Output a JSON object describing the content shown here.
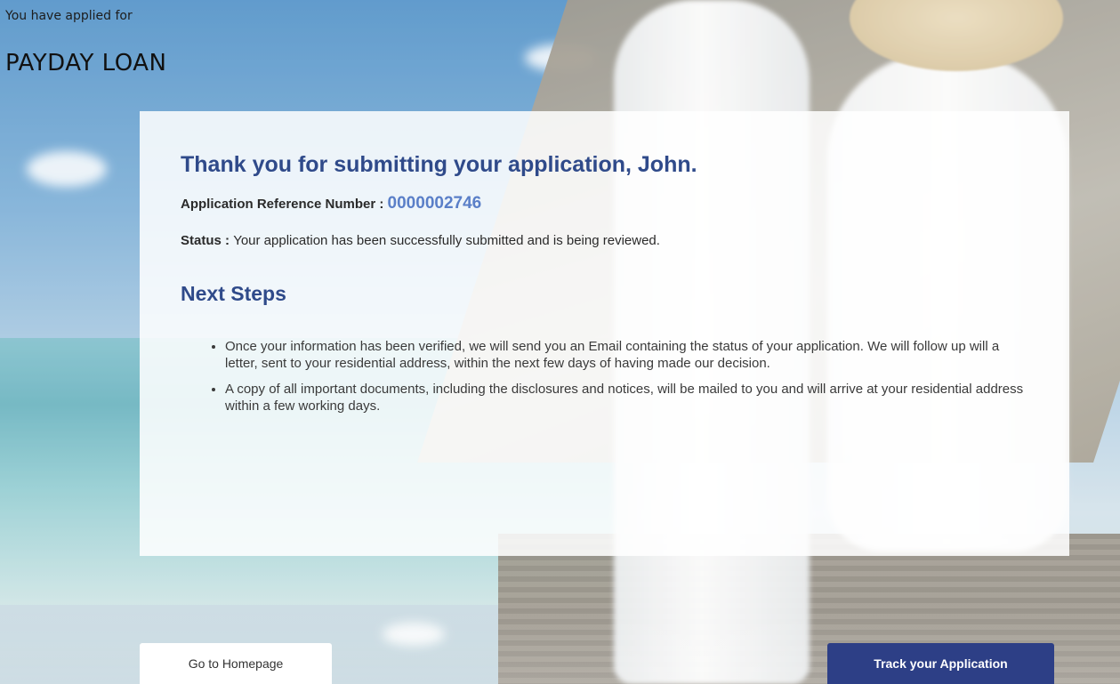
{
  "header": {
    "applied_label": "You have applied for",
    "product_title": "PAYDAY LOAN"
  },
  "confirmation": {
    "thank_you": "Thank you for submitting your application, John.",
    "ref_label": "Application Reference Number : ",
    "ref_number": "0000002746",
    "status_label": "Status : ",
    "status_text": "Your application has been successfully submitted and is being reviewed."
  },
  "next_steps": {
    "heading": "Next Steps",
    "items": [
      "Once your information has been verified, we will send you an Email containing the status of your application. We will follow up will a letter, sent to your residential address, within the next few days of having made our decision.",
      "A copy of all important documents, including the disclosures and notices, will be mailed to you and will arrive at your residential address within a few working days."
    ]
  },
  "actions": {
    "home_label": "Go to Homepage",
    "track_label": "Track your Application"
  },
  "colors": {
    "heading": "#2f4a8a",
    "ref_number": "#5a7fc8",
    "primary_button": "#2d3f86"
  }
}
